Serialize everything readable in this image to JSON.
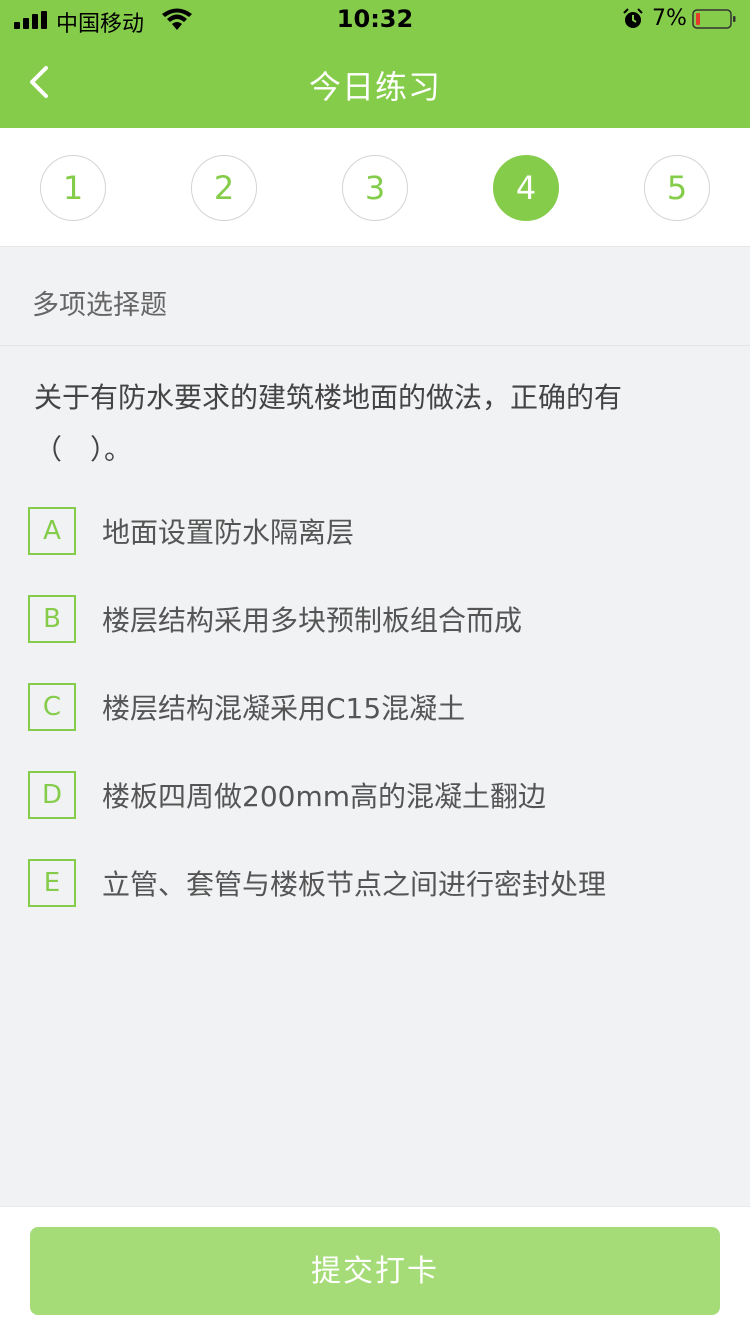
{
  "status_bar": {
    "carrier": "中国移动",
    "time": "10:32",
    "battery_percent": "7%"
  },
  "header": {
    "title": "今日练习",
    "back_icon": "chevron-left-icon"
  },
  "steps": {
    "items": [
      "1",
      "2",
      "3",
      "4",
      "5"
    ],
    "active": "4"
  },
  "question": {
    "type_label": "多项选择题",
    "text": "关于有防水要求的建筑楼地面的做法，正确的有（　）。",
    "options": [
      {
        "letter": "A",
        "text": "地面设置防水隔离层"
      },
      {
        "letter": "B",
        "text": "楼层结构采用多块预制板组合而成"
      },
      {
        "letter": "C",
        "text": "楼层结构混凝采用C15混凝土"
      },
      {
        "letter": "D",
        "text": "楼板四周做200mm高的混凝土翻边"
      },
      {
        "letter": "E",
        "text": "立管、套管与楼板节点之间进行密封处理"
      }
    ]
  },
  "footer": {
    "submit_label": "提交打卡"
  },
  "colors": {
    "accent": "#85cc4b",
    "submit_disabled": "#a6dc78",
    "background": "#f1f2f4"
  }
}
